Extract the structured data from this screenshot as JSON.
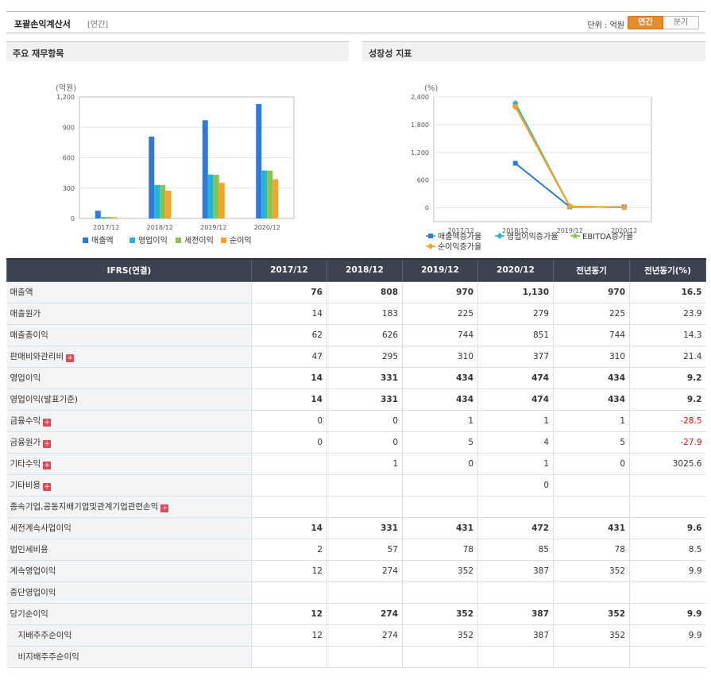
{
  "header": {
    "title": "포괄손익계산서",
    "subtitle": "[연간]",
    "unit_label": "단위 : 억원",
    "toggle": [
      "연간",
      "분기"
    ]
  },
  "left_panel": {
    "title": "주요 재무항목"
  },
  "right_panel": {
    "title": "성장성 지표"
  },
  "chart_data": [
    {
      "type": "bar",
      "title": "",
      "unit": "(억원)",
      "categories": [
        "2017/12",
        "2018/12",
        "2019/12",
        "2020/12"
      ],
      "ylim": [
        0,
        1200
      ],
      "yticks": [
        0,
        300,
        600,
        900,
        1200
      ],
      "ytick_labels": [
        "0",
        "300",
        "600",
        "900",
        "1,200"
      ],
      "grid": true,
      "legend": "bottom",
      "series": [
        {
          "name": "매출액",
          "color": "#2f79d8",
          "values": [
            76,
            808,
            970,
            1130
          ]
        },
        {
          "name": "영업이익",
          "color": "#1fb7d3",
          "values": [
            14,
            331,
            434,
            474
          ]
        },
        {
          "name": "세전이익",
          "color": "#8bc34a",
          "values": [
            14,
            331,
            431,
            472
          ]
        },
        {
          "name": "순이익",
          "color": "#fba12a",
          "values": [
            12,
            274,
            352,
            387
          ]
        }
      ]
    },
    {
      "type": "line",
      "title": "",
      "unit": "(%)",
      "categories": [
        "2017/12",
        "2018/12",
        "2019/12",
        "2020/12"
      ],
      "ylim": [
        -300,
        2400
      ],
      "yticks": [
        0,
        600,
        1200,
        1800,
        2400
      ],
      "ytick_labels": [
        "0",
        "600",
        "1,200",
        "1,800",
        "2,400"
      ],
      "grid": true,
      "legend": "bottom",
      "series": [
        {
          "name": "매출액증가율",
          "color": "#2f79d8",
          "marker": "square",
          "values": [
            null,
            963,
            20,
            16.5
          ]
        },
        {
          "name": "영업이익증가율",
          "color": "#1fb7d3",
          "marker": "diamond",
          "values": [
            null,
            2264,
            31,
            9.2
          ]
        },
        {
          "name": "EBITDA증가율",
          "color": "#8bc34a",
          "marker": "star",
          "values": [
            null,
            2200,
            30,
            9.0
          ]
        },
        {
          "name": "순이익증가율",
          "color": "#fba12a",
          "marker": "diamond",
          "values": [
            null,
            2183,
            28,
            9.9
          ]
        }
      ]
    }
  ],
  "table": {
    "headers": [
      "IFRS(연결)",
      "2017/12",
      "2018/12",
      "2019/12",
      "2020/12",
      "전년동기",
      "전년동기(%)"
    ],
    "rows": [
      {
        "label": "매출액",
        "bold": true,
        "values": [
          "76",
          "808",
          "970",
          "1,130",
          "970",
          "16.5"
        ]
      },
      {
        "label": "매출원가",
        "values": [
          "14",
          "183",
          "225",
          "279",
          "225",
          "23.9"
        ]
      },
      {
        "label": "매출총이익",
        "values": [
          "62",
          "626",
          "744",
          "851",
          "744",
          "14.3"
        ]
      },
      {
        "label": "판매비와관리비",
        "expand": true,
        "values": [
          "47",
          "295",
          "310",
          "377",
          "310",
          "21.4"
        ]
      },
      {
        "label": "영업이익",
        "bold": true,
        "values": [
          "14",
          "331",
          "434",
          "474",
          "434",
          "9.2"
        ]
      },
      {
        "label": "영업이익(발표기준)",
        "bold": true,
        "values": [
          "14",
          "331",
          "434",
          "474",
          "434",
          "9.2"
        ]
      },
      {
        "label": "금융수익",
        "expand": true,
        "values": [
          "0",
          "0",
          "1",
          "1",
          "1",
          "-28.5"
        ]
      },
      {
        "label": "금융원가",
        "expand": true,
        "values": [
          "0",
          "0",
          "5",
          "4",
          "5",
          "-27.9"
        ]
      },
      {
        "label": "기타수익",
        "expand": true,
        "values": [
          "",
          "1",
          "0",
          "1",
          "0",
          "3025.6"
        ]
      },
      {
        "label": "기타비용",
        "expand": true,
        "values": [
          "",
          "",
          "",
          "0",
          "",
          ""
        ]
      },
      {
        "label": "종속기업,공동지배기업및관계기업관련손익",
        "expand": true,
        "values": [
          "",
          "",
          "",
          "",
          "",
          ""
        ]
      },
      {
        "label": "세전계속사업이익",
        "bold": true,
        "values": [
          "14",
          "331",
          "431",
          "472",
          "431",
          "9.6"
        ]
      },
      {
        "label": "법인세비용",
        "values": [
          "2",
          "57",
          "78",
          "85",
          "78",
          "8.5"
        ]
      },
      {
        "label": "계속영업이익",
        "values": [
          "12",
          "274",
          "352",
          "387",
          "352",
          "9.9"
        ]
      },
      {
        "label": "중단영업이익",
        "values": [
          "",
          "",
          "",
          "",
          "",
          ""
        ]
      },
      {
        "label": "당기순이익",
        "bold": true,
        "values": [
          "12",
          "274",
          "352",
          "387",
          "352",
          "9.9"
        ]
      },
      {
        "label": "지배주주순이익",
        "sub": true,
        "values": [
          "12",
          "274",
          "352",
          "387",
          "352",
          "9.9"
        ]
      },
      {
        "label": "비지배주주순이익",
        "sub": true,
        "values": [
          "",
          "",
          "",
          "",
          "",
          ""
        ]
      }
    ]
  }
}
